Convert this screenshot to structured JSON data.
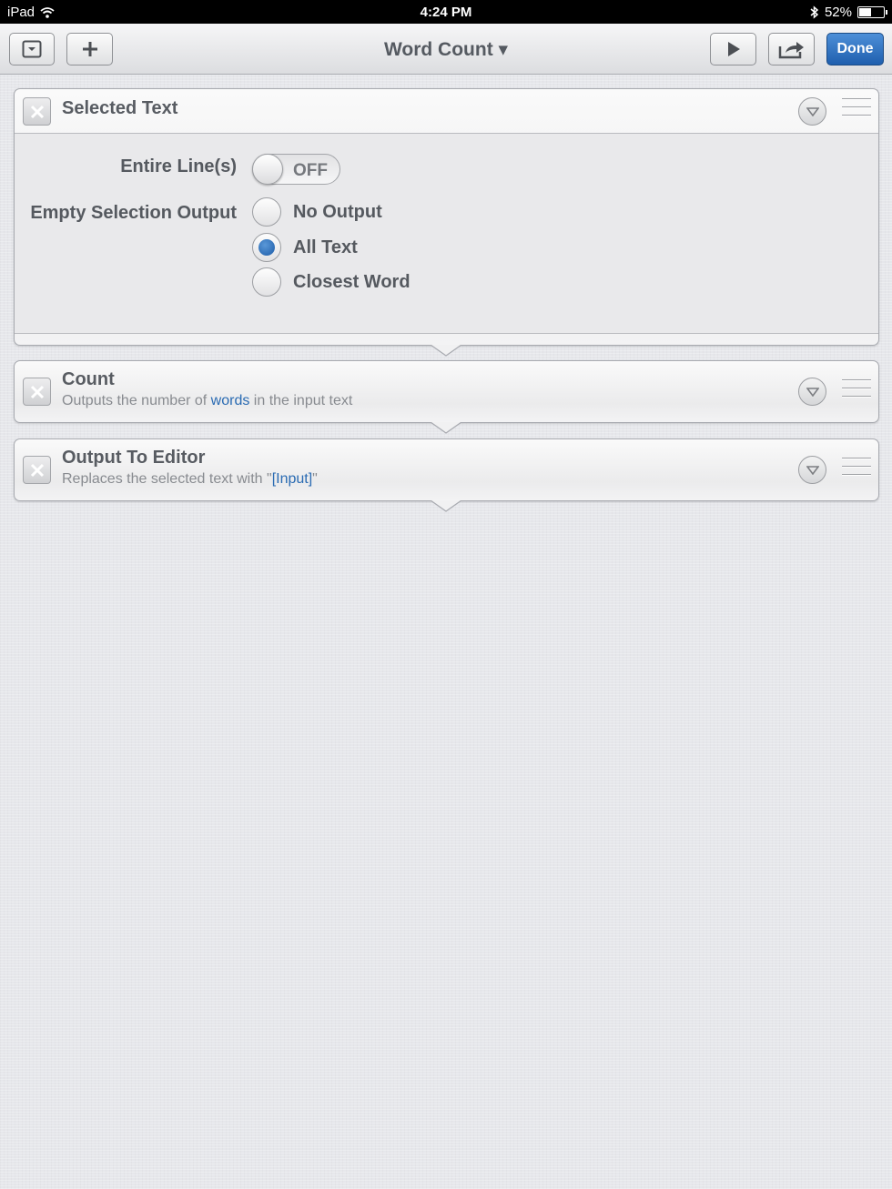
{
  "status_bar": {
    "device": "iPad",
    "time": "4:24 PM",
    "battery": "52%",
    "battery_level": 0.52
  },
  "toolbar": {
    "title": "Word Count ▾",
    "done_label": "Done"
  },
  "actions": [
    {
      "title": "Selected Text",
      "options": {
        "entire_lines_label": "Entire Line(s)",
        "entire_lines_value": "OFF",
        "empty_selection_label": "Empty Selection Output",
        "radio_options": [
          "No Output",
          "All Text",
          "Closest Word"
        ],
        "selected": "All Text"
      }
    },
    {
      "title": "Count",
      "subtitle_pre": "Outputs the number of ",
      "subtitle_link": "words",
      "subtitle_post": " in the input text"
    },
    {
      "title": "Output To Editor",
      "subtitle_pre": "Replaces the selected text with \"",
      "subtitle_link": "[Input]",
      "subtitle_post": "\""
    }
  ],
  "colors": {
    "accent": "#2a6bb3",
    "done_button": "#1f5fae",
    "background": "#e6e7eb"
  }
}
